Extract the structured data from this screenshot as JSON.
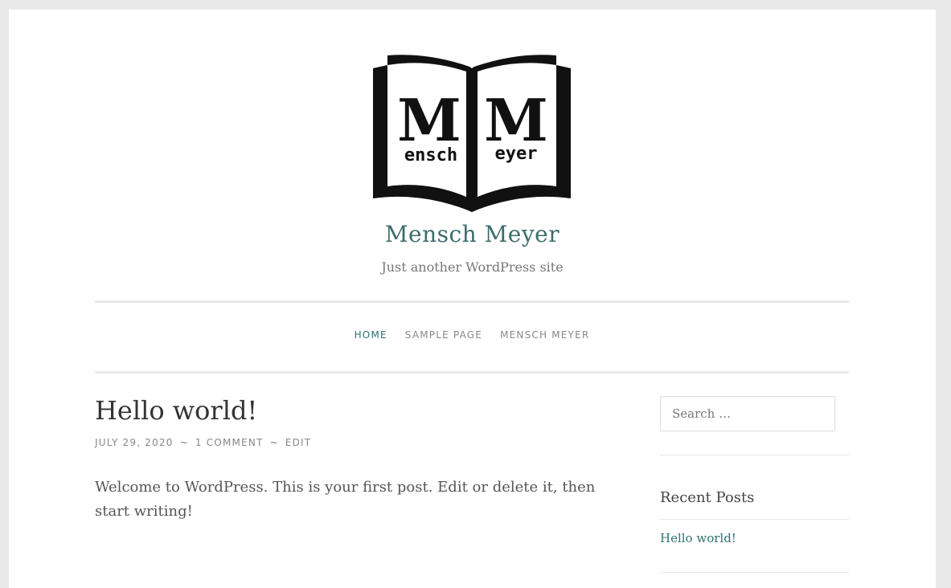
{
  "site": {
    "title": "Mensch Meyer",
    "tagline": "Just another WordPress site",
    "logo_left_letter": "M",
    "logo_left_word": "ensch",
    "logo_right_letter": "M",
    "logo_right_word": "eyer"
  },
  "nav": {
    "items": [
      {
        "label": "HOME",
        "current": true
      },
      {
        "label": "SAMPLE PAGE",
        "current": false
      },
      {
        "label": "MENSCH MEYER",
        "current": false
      }
    ]
  },
  "post": {
    "title": "Hello world!",
    "date": "JULY 29, 2020",
    "separator": "~",
    "comments": "1 COMMENT",
    "edit": "EDIT",
    "body": "Welcome to WordPress. This is your first post. Edit or delete it, then start writing!"
  },
  "sidebar": {
    "search_placeholder": "Search …",
    "recent_posts_title": "Recent Posts",
    "recent_posts": [
      "Hello world!"
    ]
  },
  "colors": {
    "accent": "#2f7272",
    "background": "#e9e9e9",
    "page": "#ffffff"
  }
}
